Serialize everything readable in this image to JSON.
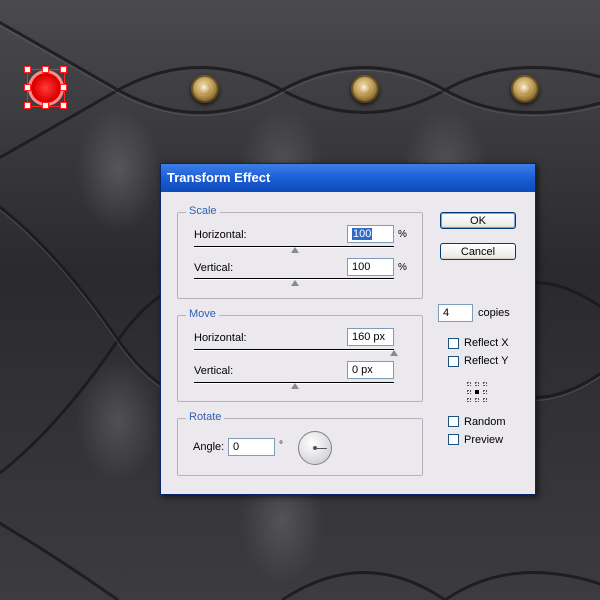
{
  "dialog": {
    "title": "Transform Effect",
    "scale": {
      "group_label": "Scale",
      "horizontal_label": "Horizontal:",
      "horizontal_value": "100",
      "horizontal_unit": "%",
      "vertical_label": "Vertical:",
      "vertical_value": "100",
      "vertical_unit": "%"
    },
    "move": {
      "group_label": "Move",
      "horizontal_label": "Horizontal:",
      "horizontal_value": "160 px",
      "vertical_label": "Vertical:",
      "vertical_value": "0 px"
    },
    "rotate": {
      "group_label": "Rotate",
      "angle_label": "Angle:",
      "angle_value": "0",
      "angle_unit": "°"
    },
    "ok_label": "OK",
    "cancel_label": "Cancel",
    "copies_value": "4",
    "copies_label": "copies",
    "reflect_x_label": "Reflect X",
    "reflect_y_label": "Reflect Y",
    "random_label": "Random",
    "preview_label": "Preview",
    "reflect_x_checked": false,
    "reflect_y_checked": false,
    "random_checked": false,
    "preview_checked": false
  },
  "colors": {
    "titlebar": "#1c5ed6",
    "group_title": "#2f5fb8",
    "dialog_bg": "#ebe9ed",
    "selection": "#ff2020"
  },
  "icons": {
    "reference_point": "reference-point-icon",
    "angle_dial": "angle-dial-icon"
  }
}
